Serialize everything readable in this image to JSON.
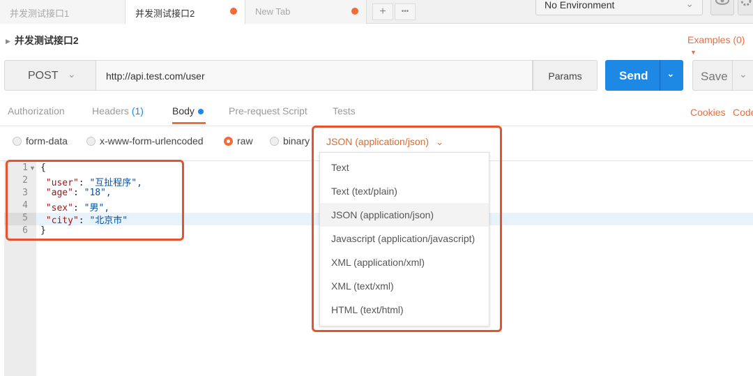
{
  "tabs": [
    {
      "label": "并发测试接口1",
      "active": false,
      "unsaved": false
    },
    {
      "label": "并发测试接口2",
      "active": true,
      "unsaved": true
    },
    {
      "label": "New Tab",
      "active": false,
      "unsaved": true
    }
  ],
  "tab_actions": {
    "add": "+",
    "more": "•••"
  },
  "environment": {
    "selected": "No Environment"
  },
  "request": {
    "name": "并发测试接口2",
    "examples_label": "Examples (0)",
    "method": "POST",
    "url": "http://api.test.com/user",
    "params_label": "Params",
    "send_label": "Send",
    "save_label": "Save"
  },
  "subtabs": [
    {
      "label": "Authorization"
    },
    {
      "label": "Headers",
      "count": "(1)"
    },
    {
      "label": "Body",
      "active": true
    },
    {
      "label": "Pre-request Script"
    },
    {
      "label": "Tests"
    }
  ],
  "links": {
    "cookies": "Cookies",
    "code": "Code"
  },
  "body_types": [
    {
      "label": "form-data",
      "selected": false
    },
    {
      "label": "x-www-form-urlencoded",
      "selected": false
    },
    {
      "label": "raw",
      "selected": true
    },
    {
      "label": "binary",
      "selected": false
    }
  ],
  "content_type": {
    "selected": "JSON (application/json)"
  },
  "content_type_options": [
    "Text",
    "Text (text/plain)",
    "JSON (application/json)",
    "Javascript (application/javascript)",
    "XML (application/xml)",
    "XML (text/xml)",
    "HTML (text/html)"
  ],
  "editor": {
    "line_numbers": [
      "1",
      "2",
      "3",
      "4",
      "5",
      "6"
    ],
    "lines": [
      {
        "open": "{"
      },
      {
        "key": "\"user\"",
        "value": "\"互扯程序\","
      },
      {
        "key": "\"age\"",
        "value": "\"18\","
      },
      {
        "key": "\"sex\"",
        "value": "\"男\","
      },
      {
        "key": "\"city\"",
        "value": "\"北京市\""
      },
      {
        "close": "}"
      }
    ]
  },
  "colors": {
    "accent": "#f26b3a",
    "primary": "#1e88e5",
    "highlight_frame": "#e2532e"
  }
}
